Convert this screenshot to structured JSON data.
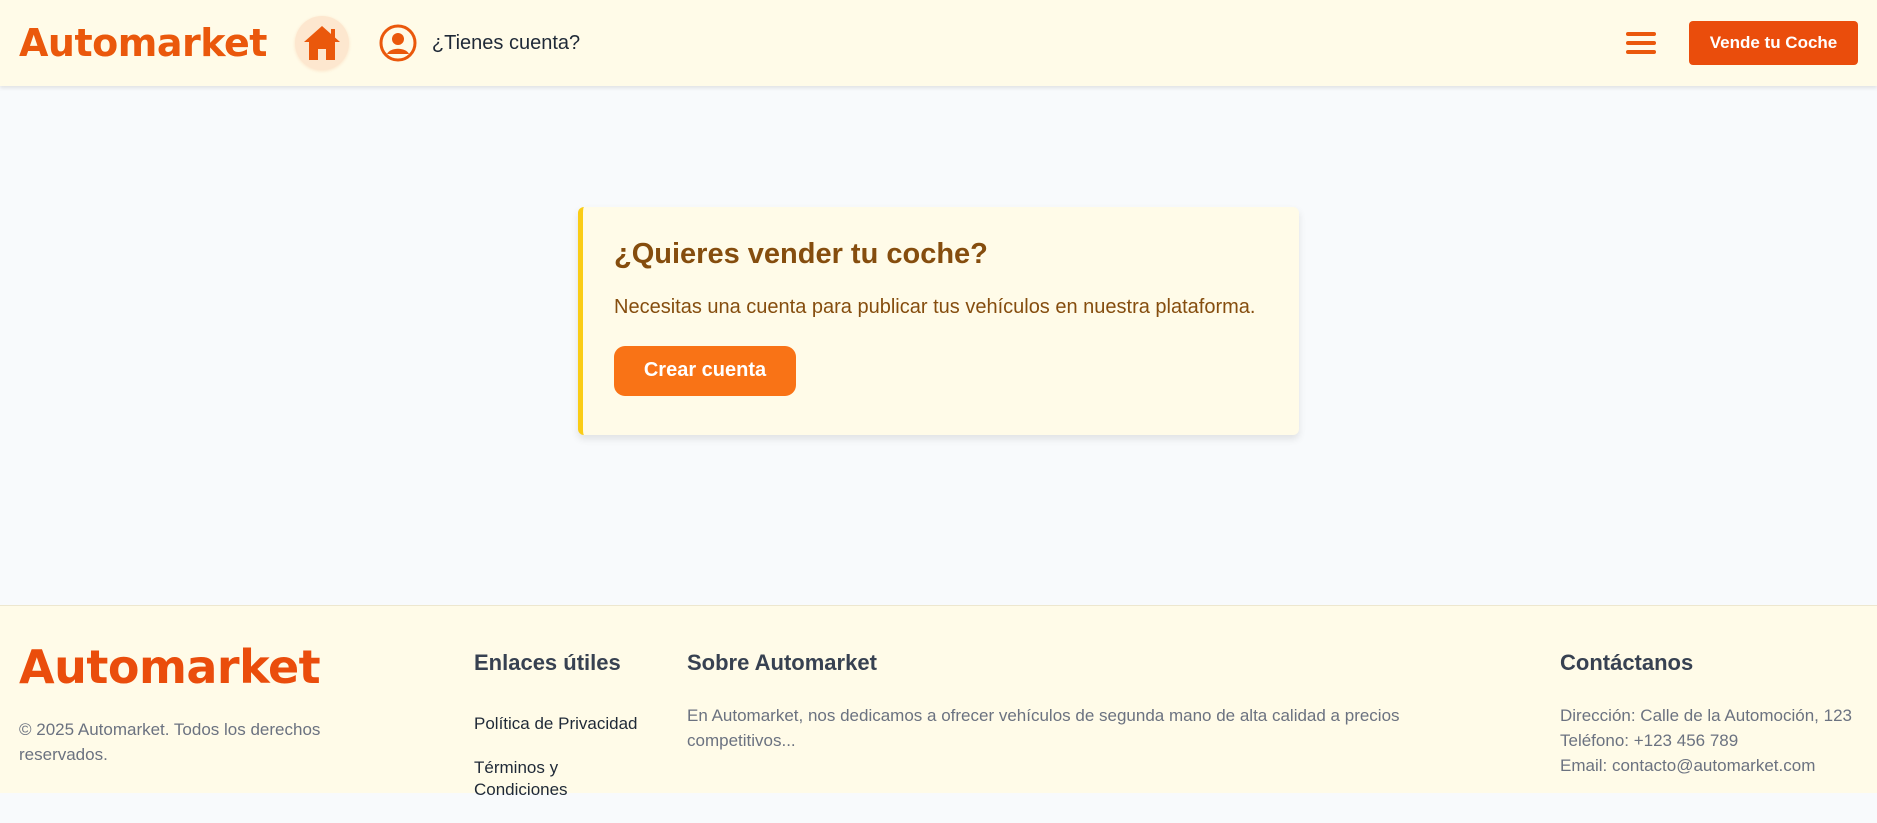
{
  "header": {
    "brand": "Automarket",
    "account_link": "¿Tienes cuenta?",
    "sell_button": "Vende tu Coche",
    "home_icon": "home-icon",
    "user_icon": "user-circle-icon",
    "menu_icon": "hamburger-menu-icon"
  },
  "main": {
    "title": "¿Quieres vender tu coche?",
    "text": "Necesitas una cuenta para publicar tus vehículos en nuestra plataforma.",
    "button": "Crear cuenta"
  },
  "footer": {
    "brand": "Automarket",
    "copyright": "© 2025 Automarket. Todos los derechos reservados.",
    "links_title": "Enlaces útiles",
    "links": [
      "Política de Privacidad",
      "Términos y Condiciones"
    ],
    "about_title": "Sobre Automarket",
    "about_text": "En Automarket, nos dedicamos a ofrecer vehículos de segunda mano de alta calidad a precios competitivos...",
    "contact_title": "Contáctanos",
    "address": "Dirección: Calle de la Automoción, 123",
    "phone": "Teléfono: +123 456 789",
    "email": "Email: contacto@automarket.com"
  },
  "colors": {
    "brand": "#ea580c",
    "accent_button": "#ea4d0c",
    "cta_button": "#f97316",
    "card_bg": "#fffbe8",
    "card_border": "#facc15",
    "card_text": "#854d0e"
  }
}
